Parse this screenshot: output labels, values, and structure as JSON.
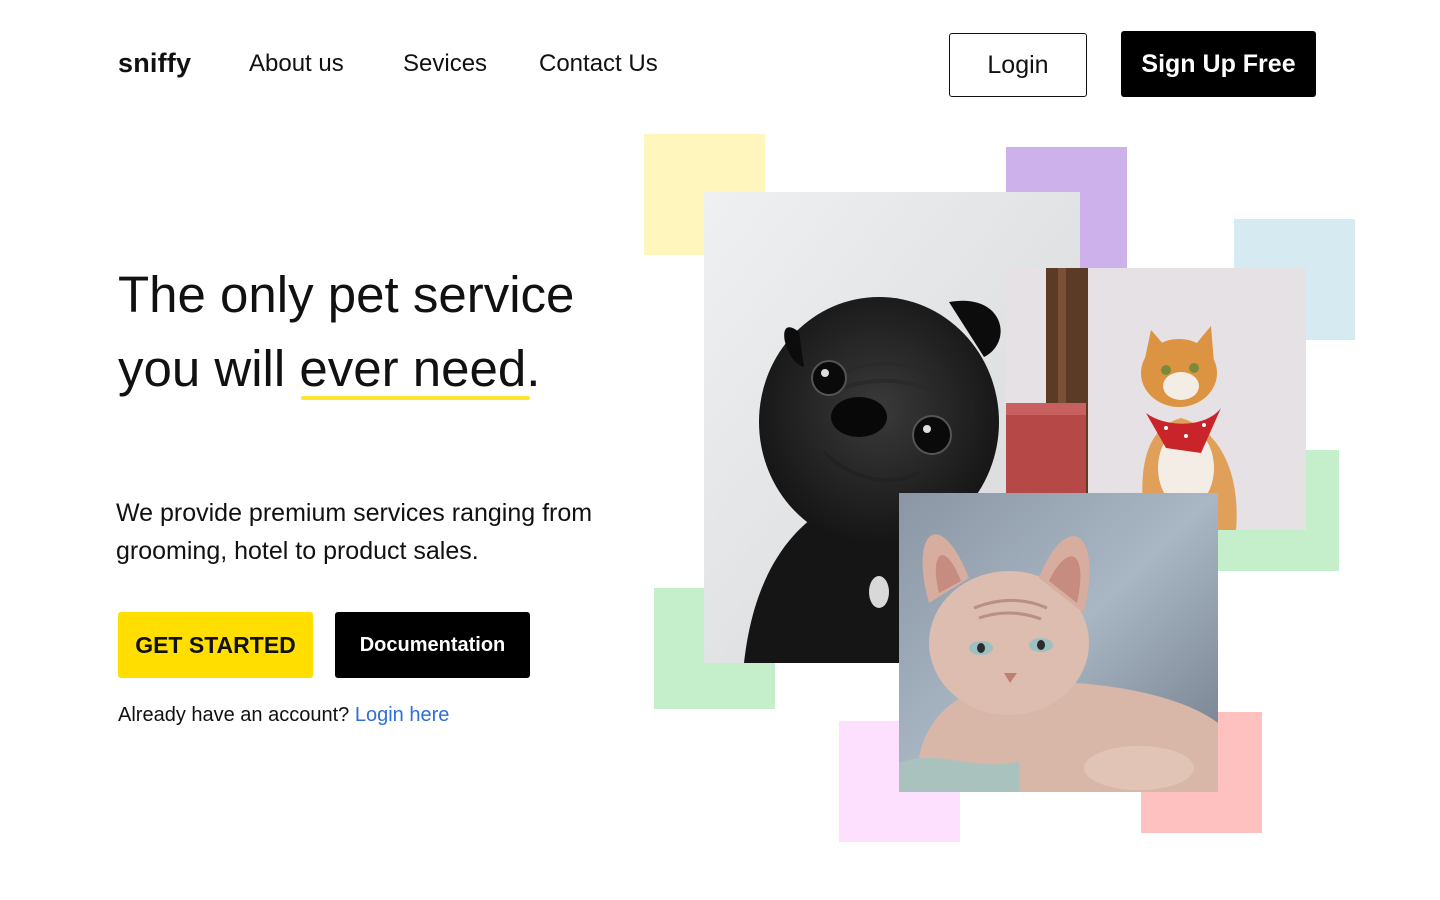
{
  "nav": {
    "logo": "sniffy",
    "links": [
      "About us",
      "Sevices",
      "Contact Us"
    ],
    "login_label": "Login",
    "signup_label": "Sign Up Free"
  },
  "hero": {
    "headline_line1": "The only pet service",
    "headline_line2_prefix": "you will ",
    "headline_accent": "ever need",
    "headline_suffix": ".",
    "description": "We provide premium services ranging from grooming, hotel to product sales.",
    "cta_primary": "GET STARTED",
    "cta_secondary": "Documentation",
    "account_prompt": "Already have an account?",
    "account_link": "Login here"
  },
  "colors": {
    "accent_yellow": "#ffde00",
    "underline_yellow": "#ffe32e",
    "link_blue": "#2f6fd6",
    "square_yellow": "#fff6bd",
    "square_purple": "#cdb1ea",
    "square_blue": "#d6ebf1",
    "square_green": "#c4efca",
    "square_pink": "#fde0fe",
    "square_red": "#ffc0c0"
  },
  "images": {
    "pug": "black pug photo",
    "ginger_cat": "ginger cat with red bandana photo",
    "sphynx_cat": "sphynx cat photo"
  }
}
